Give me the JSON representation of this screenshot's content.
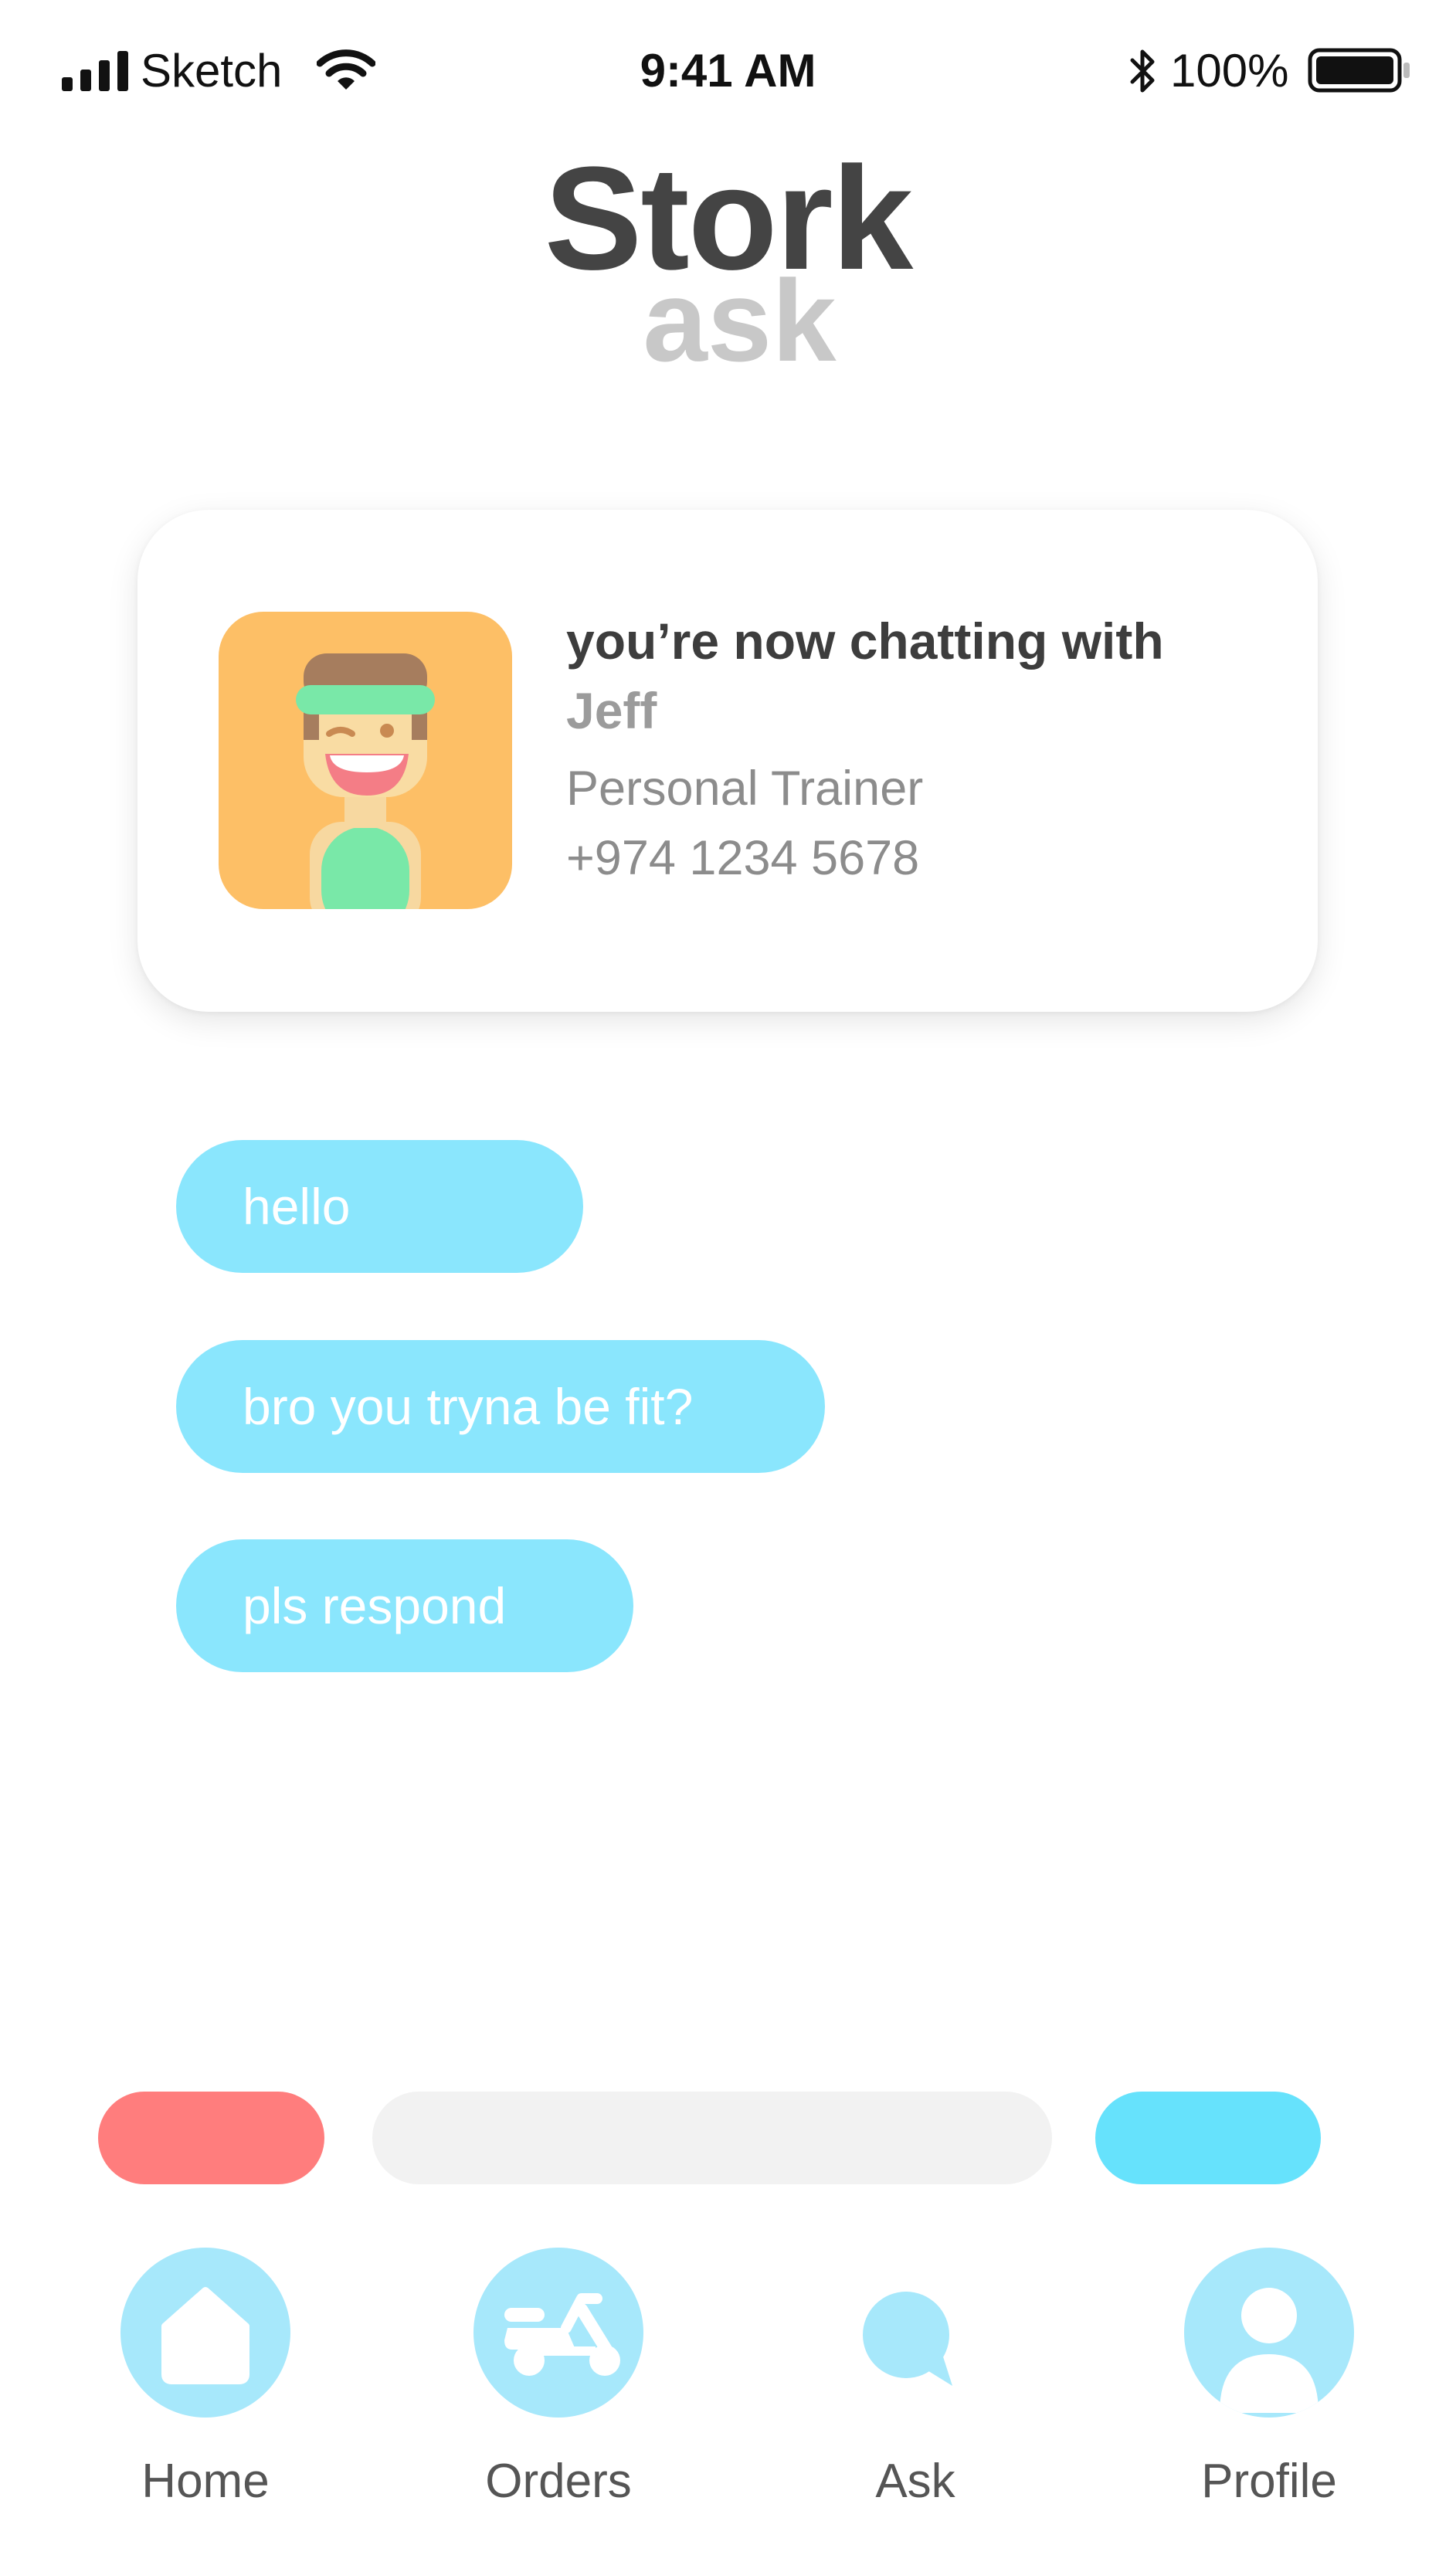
{
  "status_bar": {
    "carrier": "Sketch",
    "time": "9:41 AM",
    "battery": "100%"
  },
  "brand": {
    "title": "Stork",
    "subtitle": "ask"
  },
  "contact_card": {
    "heading_prefix": "you’re now chatting with ",
    "name": "Jeff",
    "role": "Personal Trainer",
    "phone": "+974 1234 5678"
  },
  "messages": [
    {
      "text": "hello"
    },
    {
      "text": "bro you tryna be fit?"
    },
    {
      "text": "pls respond"
    }
  ],
  "composer": {
    "input_value": "",
    "decline_color": "#ff7d7d",
    "send_color": "#66e2fc"
  },
  "nav": {
    "items": [
      {
        "label": "Home",
        "icon": "home-icon"
      },
      {
        "label": "Orders",
        "icon": "scooter-icon"
      },
      {
        "label": "Ask",
        "icon": "chat-bubble-icon"
      },
      {
        "label": "Profile",
        "icon": "user-icon"
      }
    ],
    "active_color": "#a7e8fb"
  },
  "colors": {
    "bubble": "#8ae6fd",
    "title": "#444444",
    "subtitle": "#c8c8c8"
  }
}
